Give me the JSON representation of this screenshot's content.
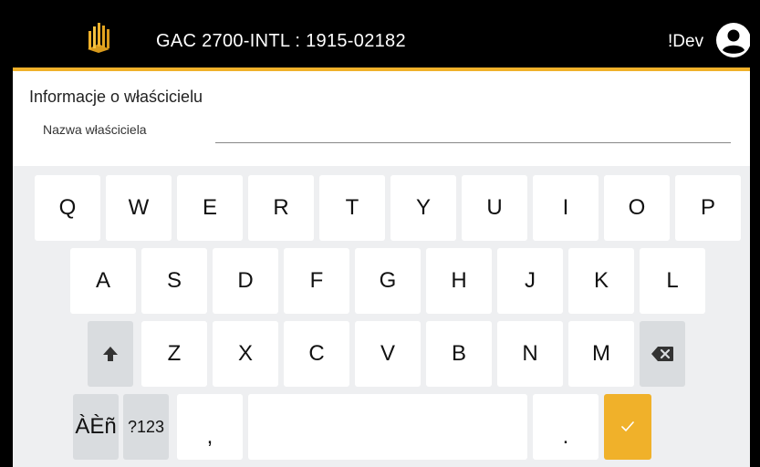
{
  "header": {
    "title": "GAC 2700-INTL : 1915-02182",
    "user_label": "!Dev",
    "logo_icon": "gac-logo",
    "user_icon": "account-circle-icon",
    "accent_color": "#f0b12a"
  },
  "form": {
    "section_title": "Informacje o właścicielu",
    "field_label": "Nazwa właściciela",
    "field_value": ""
  },
  "keyboard": {
    "row1": [
      "Q",
      "W",
      "E",
      "R",
      "T",
      "Y",
      "U",
      "I",
      "O",
      "P"
    ],
    "row2": [
      "A",
      "S",
      "D",
      "F",
      "G",
      "H",
      "J",
      "K",
      "L"
    ],
    "row3": [
      "Z",
      "X",
      "C",
      "V",
      "B",
      "N",
      "M"
    ],
    "shift_icon": "shift-arrow-icon",
    "backspace_icon": "backspace-icon",
    "accents_label": "ÀÈñ",
    "symbols_label": "?123",
    "comma_label": ",",
    "period_label": ".",
    "enter_icon": "checkmark-icon"
  }
}
